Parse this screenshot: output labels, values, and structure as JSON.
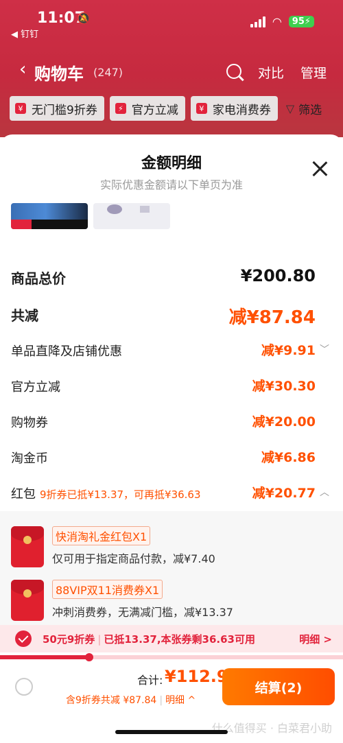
{
  "status": {
    "time": "11:07",
    "back_app": "◀ 钉钉",
    "battery": "95⚡"
  },
  "nav": {
    "title": "购物车",
    "count": "(247)",
    "compare": "对比",
    "manage": "管理"
  },
  "chips": [
    "无门槛9折券",
    "官方立减",
    "家电消费券",
    "筛选"
  ],
  "sheet": {
    "title": "金额明细",
    "subtitle": "实际优惠金额请以下单页为准"
  },
  "rows": [
    {
      "label": "商品总价",
      "value": "¥200.80"
    },
    {
      "label": "共减",
      "value": "减¥87.84"
    },
    {
      "label": "单品直降及店铺优惠",
      "value": "减¥9.91"
    },
    {
      "label": "官方立减",
      "value": "减¥30.30"
    },
    {
      "label": "购物券",
      "value": "减¥20.00"
    },
    {
      "label": "淘金币",
      "value": "减¥6.86"
    },
    {
      "label": "红包",
      "sub": "9折券已抵¥13.37，可再抵¥36.63",
      "value": "减¥20.77"
    }
  ],
  "hongbao": [
    {
      "tag": "快消淘礼金红包X1",
      "desc": "仅可用于指定商品付款，减¥7.40"
    },
    {
      "tag": "88VIP双11消费券X1",
      "desc": "冲刺消费券，无满减门槛，减¥13.37"
    }
  ],
  "coupon_bar": {
    "name": "50元9折券",
    "status": "已抵13.37,本张券剩36.63可用",
    "detail": "明细 >",
    "progress": 0.26
  },
  "footer": {
    "total_label": "合计:",
    "total_value": "¥112.96",
    "sub_a": "含9折券共减 ¥87.84",
    "sub_b": "明细 ^",
    "pay_button": "结算(2)",
    "watermark": "什么值得买 · 白菜君小助"
  },
  "colors": {
    "brand_red": "#e2233c",
    "accent_orange": "#ff5000"
  }
}
